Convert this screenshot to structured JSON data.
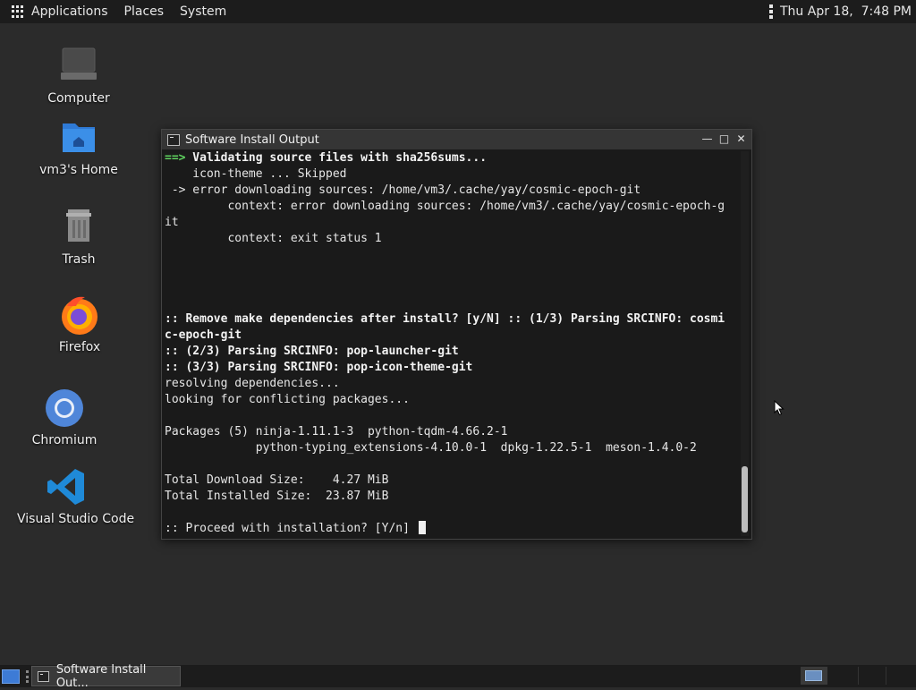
{
  "top_panel": {
    "menus": [
      "Applications",
      "Places",
      "System"
    ],
    "clock": "Thu Apr 18,  7:48 PM"
  },
  "desktop_icons": [
    {
      "label": "Computer",
      "icon": "computer-icon"
    },
    {
      "label": "vm3's Home",
      "icon": "home-folder-icon"
    },
    {
      "label": "Trash",
      "icon": "trash-icon"
    },
    {
      "label": "Firefox",
      "icon": "firefox-icon"
    },
    {
      "label": "Chromium",
      "icon": "chromium-icon"
    },
    {
      "label": "Visual Studio Code",
      "icon": "vscode-icon"
    }
  ],
  "terminal": {
    "title": "Software Install Output",
    "lines": {
      "l1_arrow": "==>",
      "l1_text": " Validating source files with sha256sums...",
      "l2": "    icon-theme ... Skipped",
      "l3": " -> error downloading sources: /home/vm3/.cache/yay/cosmic-epoch-git",
      "l4": "         context: error downloading sources: /home/vm3/.cache/yay/cosmic-epoch-g",
      "l5": "it",
      "l6": "         context: exit status 1",
      "l7": ":: Remove make dependencies after install? [y/N] :: (1/3) Parsing SRCINFO: cosmi",
      "l8": "c-epoch-git",
      "l9": ":: (2/3) Parsing SRCINFO: pop-launcher-git",
      "l10": ":: (3/3) Parsing SRCINFO: pop-icon-theme-git",
      "l11": "resolving dependencies...",
      "l12": "looking for conflicting packages...",
      "l13": "Packages (5) ninja-1.11.1-3  python-tqdm-4.66.2-1",
      "l14": "             python-typing_extensions-4.10.0-1  dpkg-1.22.5-1  meson-1.4.0-2",
      "l15": "Total Download Size:    4.27 MiB",
      "l16": "Total Installed Size:  23.87 MiB",
      "l17": ":: Proceed with installation? [Y/n] "
    }
  },
  "taskbar": {
    "task_label": "Software Install Out..."
  },
  "colors": {
    "desktop_bg": "#2b2b2b",
    "panel_bg": "#1c1c1c",
    "terminal_bg": "#1a1a1a",
    "prompt_green": "#5fd35f"
  }
}
